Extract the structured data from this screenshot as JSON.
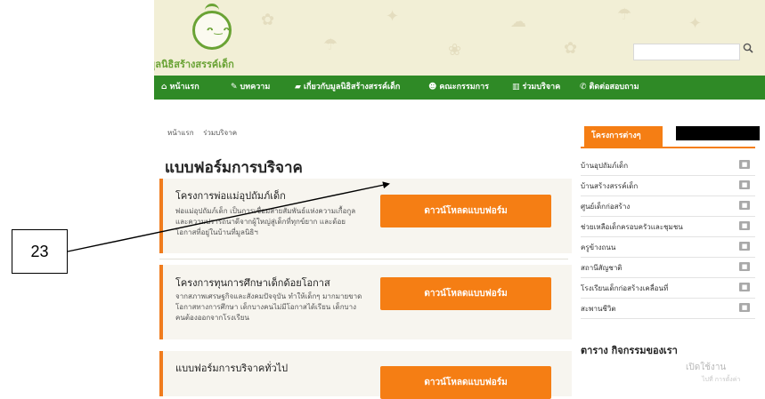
{
  "logo": {
    "name": "มูลนิธิสร้างสรรค์เด็ก",
    "face": "ᴖ‿ᴖ"
  },
  "nav": [
    {
      "icon": "home-icon",
      "label": "หน้าแรก"
    },
    {
      "icon": "edit-icon",
      "label": "บทความ"
    },
    {
      "icon": "book-icon",
      "label": "เกี่ยวกับมูลนิธิสร้างสรรค์เด็ก"
    },
    {
      "icon": "group-icon",
      "label": "คณะกรรมการ"
    },
    {
      "icon": "gift-icon",
      "label": "ร่วมบริจาค"
    },
    {
      "icon": "phone-icon",
      "label": "ติดต่อสอบถาม"
    }
  ],
  "breadcrumb": [
    "หน้าแรก",
    "ร่วมบริจาค"
  ],
  "page_title": "แบบฟอร์มการบริจาค",
  "rows": [
    {
      "title": "โครงการพ่อแม่อุปถัมภ์เด็ก",
      "desc": "พ่อแม่อุปถัมภ์เด็ก เป็นการเชื่อมสายสัมพันธ์แห่งความเกื้อกูล และความปรารถนาดีจากผู้ใหญ่สู่เด็กที่ทุกข์ยาก และด้อยโอกาสที่อยู่ในบ้านที่มูลนิธิฯ",
      "button": "ดาวน์โหลดแบบฟอร์ม"
    },
    {
      "title": "โครงการทุนการศึกษาเด็กด้อยโอกาส",
      "desc": "จากสภาพเศรษฐกิจและสังคมปัจจุบัน ทำให้เด็กๆ มากมายขาดโอกาสทางการศึกษา เด็กบางคนไม่มีโอกาสได้เรียน เด็กบางคนต้องออกจากโรงเรียน",
      "button": "ดาวน์โหลดแบบฟอร์ม"
    },
    {
      "title": "แบบฟอร์มการบริจาคทั่วไป",
      "desc": "",
      "button": "ดาวน์โหลดแบบฟอร์ม"
    }
  ],
  "sidebar": {
    "tab": "โครงการต่างๆ",
    "items": [
      "บ้านอุปถัมภ์เด็ก",
      "บ้านสร้างสรรค์เด็ก",
      "ศูนย์เด็กก่อสร้าง",
      "ช่วยเหลือเด็กครอบครัวและชุมชน",
      "ครูข้างถนน",
      "สถานีสัญชาติ",
      "โรงเรียนเด็กก่อสร้างเคลื่อนที่",
      "สะพานชีวิต"
    ],
    "bottom_title": "ตาราง กิจกรรมของเรา"
  },
  "watermark": {
    "line1": "เปิดใช้งาน",
    "line2": "ไปที่ การตั้งค่า"
  },
  "callout": {
    "label": "23"
  },
  "colors": {
    "nav_green": "#2f8a26",
    "accent_orange": "#f57e14",
    "header_bg": "#f2efd6"
  }
}
